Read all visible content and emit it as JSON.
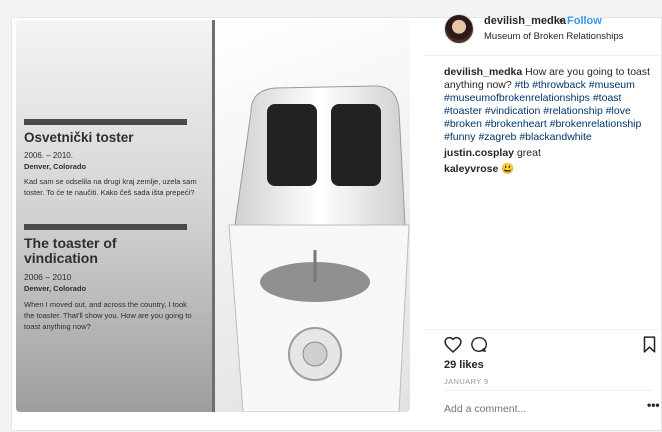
{
  "post": {
    "username": "devilish_medka",
    "separator": "•",
    "follow_label": "Follow",
    "location": "Museum of Broken Relationships",
    "likes": "29 likes",
    "date": "JANUARY 9",
    "comment_placeholder": "Add a comment...",
    "more_label": "•••",
    "caption": {
      "username": "devilish_medka",
      "text": "How are you going to toast anything now?",
      "hashtags": [
        "#tb",
        "#throwback",
        "#museum",
        "#museumofbrokenrelationships",
        "#toast",
        "#toaster",
        "#vindication",
        "#relationship",
        "#love",
        "#broken",
        "#brokenheart",
        "#brokenrelationship",
        "#funny",
        "#zagreb",
        "#blackandwhite"
      ]
    },
    "comments": [
      {
        "username": "justin.cosplay",
        "text": "great"
      },
      {
        "username": "kaleyvrose",
        "text": "😃"
      }
    ]
  },
  "photo": {
    "sign": {
      "hr_title": "Osvetnički toster",
      "hr_years": "2006. – 2010.",
      "hr_place": "Denver, Colorado",
      "hr_text": "Kad sam se odselila na drugi kraj zemlje, uzela sam toster. To će te naučiti. Kako češ sada išta prepeći?",
      "en_title": "The toaster of vindication",
      "en_years": "2006 – 2010",
      "en_place": "Denver, Colorado",
      "en_text": "When I moved out, and across the country, I took the toaster. That'll show you. How are you going to toast anything now?"
    }
  },
  "icons": {
    "like": "heart-outline-icon",
    "comment": "speech-bubble-icon",
    "save": "bookmark-icon"
  }
}
